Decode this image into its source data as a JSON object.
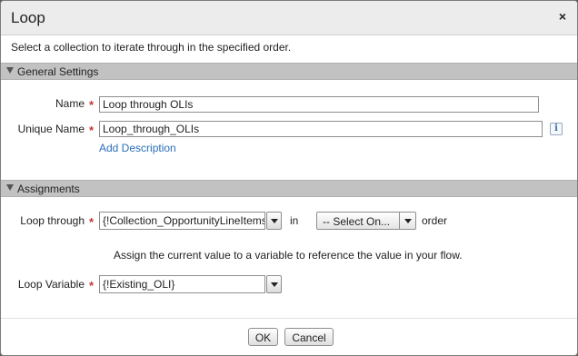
{
  "dialog": {
    "title": "Loop",
    "close_glyph": "×",
    "description": "Select a collection to iterate through in the specified order."
  },
  "general_settings": {
    "header": "General Settings",
    "name_label": "Name",
    "name_value": "Loop through OLIs",
    "unique_name_label": "Unique Name",
    "unique_name_value": "Loop_through_OLIs",
    "info_glyph": "i",
    "add_description": "Add Description"
  },
  "assignments": {
    "header": "Assignments",
    "loop_through_label": "Loop through",
    "loop_through_value": "{!Collection_OpportunityLineItems}",
    "in_text": "in",
    "order_select": "-- Select On...",
    "order_text": "order",
    "hint": "Assign the current value to a variable to reference the value in your flow.",
    "loop_variable_label": "Loop Variable",
    "loop_variable_value": "{!Existing_OLI}"
  },
  "footer": {
    "ok_label": "OK",
    "cancel_label": "Cancel"
  },
  "required_marker": "*",
  "colors": {
    "required": "#c23934",
    "link": "#2a6fb8",
    "section_header": "#c2c2c2",
    "titlebar": "#ececec"
  }
}
